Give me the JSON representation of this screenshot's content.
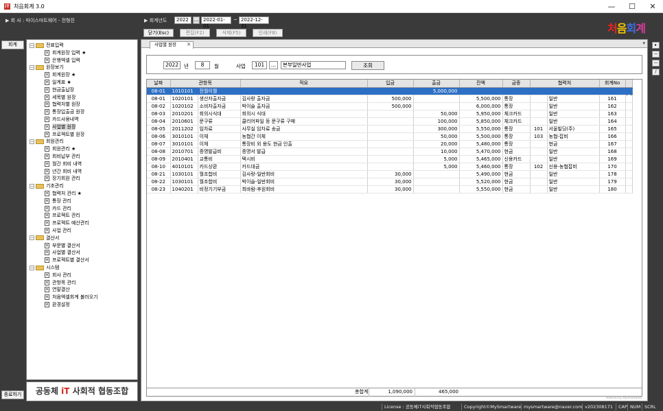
{
  "window": {
    "title": "처음회계 3.0",
    "app_icon": "iT",
    "minimize": "—",
    "maximize": "☐",
    "close": "✕"
  },
  "infobar": {
    "company_label": "▶ 회   사 : 마이스마트웨어 - 전형진",
    "fiscal_label": "▶ 회계년도",
    "fiscal_year": "2022",
    "dots": "...",
    "date_from": "2022-01-01",
    "tilde": "~",
    "date_to": "2022-12-31",
    "buttons": {
      "close": "닫기(Esc)",
      "edit": "편집(F2)",
      "delete": "삭제(F5)",
      "print": "인쇄(F8)"
    },
    "brand": [
      "처",
      "음",
      "회",
      "계"
    ],
    "brand_colors": [
      "#e8251f",
      "#f5c400",
      "#3e6de0",
      "#d63b9a"
    ]
  },
  "leftstrip": {
    "accounting_btn": "회계",
    "help_btn": "종료하기"
  },
  "tree": [
    {
      "type": "group",
      "label": "전표입력"
    },
    {
      "type": "item",
      "label": "회계원장 입력 ★"
    },
    {
      "type": "item",
      "label": "은행엑셀 입력"
    },
    {
      "type": "group",
      "label": "원장보기"
    },
    {
      "type": "item",
      "label": "회계원장 ★"
    },
    {
      "type": "item",
      "label": "일계표 ★"
    },
    {
      "type": "item",
      "label": "현금출납장"
    },
    {
      "type": "item",
      "label": "세목별 원장"
    },
    {
      "type": "item",
      "label": "협력처별 원장"
    },
    {
      "type": "item",
      "label": "통장입출금 원장"
    },
    {
      "type": "item",
      "label": "카드사용내역"
    },
    {
      "type": "item",
      "label": "사업별 원장",
      "selected": true
    },
    {
      "type": "item",
      "label": "프로젝트별 원장"
    },
    {
      "type": "group",
      "label": "회원관리"
    },
    {
      "type": "item",
      "label": "회원관리 ★"
    },
    {
      "type": "item",
      "label": "회비납부 관리"
    },
    {
      "type": "item",
      "label": "월간 회비 내역"
    },
    {
      "type": "item",
      "label": "년간 회비 내역"
    },
    {
      "type": "item",
      "label": "장기회원 관리"
    },
    {
      "type": "group",
      "label": "기초관리"
    },
    {
      "type": "item",
      "label": "협력처 관리 ★"
    },
    {
      "type": "item",
      "label": "통장 관리"
    },
    {
      "type": "item",
      "label": "카드 관리"
    },
    {
      "type": "item",
      "label": "프로젝트 관리"
    },
    {
      "type": "item",
      "label": "프로젝트 예산관리"
    },
    {
      "type": "item",
      "label": "사업 관리"
    },
    {
      "type": "group",
      "label": "결산서"
    },
    {
      "type": "item",
      "label": "부문별 결산서"
    },
    {
      "type": "item",
      "label": "사업별 결산서"
    },
    {
      "type": "item",
      "label": "프로젝트별 결산서"
    },
    {
      "type": "group",
      "label": "시스템"
    },
    {
      "type": "item",
      "label": "회사 관리"
    },
    {
      "type": "item",
      "label": "관항목 관리"
    },
    {
      "type": "item",
      "label": "연말결산"
    },
    {
      "type": "item",
      "label": "처음엑셀회계 불러오기"
    },
    {
      "type": "item",
      "label": "환경설정"
    }
  ],
  "org_name_prefix": "공동체 ",
  "org_name_it": "iT",
  "org_name_suffix": " 사회적 협동조합",
  "main": {
    "tab_label": "사업별 원장",
    "tab_close": "✕",
    "tab_arrow": "▾",
    "filter": {
      "year": "2022",
      "year_unit": "년",
      "month": "8",
      "month_unit": "월",
      "biz_label": "사업",
      "biz_code": "101",
      "dots": "...",
      "biz_name": "본부일반사업",
      "search_btn": "조회"
    },
    "columns": [
      "날짜",
      "관항목",
      "적요",
      "입금",
      "출금",
      "잔액",
      "금종",
      "협력처",
      "회계No"
    ],
    "rows": [
      [
        "08-01",
        "1010101",
        "전월이월",
        "",
        "",
        "5,000,000",
        "",
        "",
        "",
        "",
        ""
      ],
      [
        "08-01",
        "1020101",
        "생산자출자금",
        "김사랑 출자금",
        "500,000",
        "",
        "5,500,000",
        "통장",
        "",
        "일반",
        "161"
      ],
      [
        "08-02",
        "1020102",
        "소비자출자금",
        "박이슬 출자금",
        "500,000",
        "",
        "6,000,000",
        "통장",
        "",
        "일반",
        "162"
      ],
      [
        "08-03",
        "2010201",
        "회의시식대",
        "회의시 식대",
        "",
        "50,000",
        "5,950,000",
        "체크카드",
        "",
        "일반",
        "163"
      ],
      [
        "08-04",
        "2010601",
        "문구류",
        "클리어파일 등 문구류 구매",
        "",
        "100,000",
        "5,850,000",
        "체크카드",
        "",
        "일반",
        "164"
      ],
      [
        "08-05",
        "2011202",
        "임차료",
        "사무실 임차료 송금",
        "",
        "300,000",
        "5,550,000",
        "통장",
        "101",
        "서울빌딩(주)",
        "165"
      ],
      [
        "08-06",
        "3010101",
        "이체",
        "농협간 이체",
        "",
        "50,000",
        "5,500,000",
        "통장",
        "103",
        "농협-잡비",
        "166"
      ],
      [
        "08-07",
        "3010101",
        "이체",
        "통장비 외 용도 현금 인출",
        "",
        "20,000",
        "5,480,000",
        "통장",
        "",
        "현금",
        "167"
      ],
      [
        "08-08",
        "2010701",
        "증명발급비",
        "증명서 발급",
        "",
        "10,000",
        "5,470,000",
        "현금",
        "",
        "일반",
        "168"
      ],
      [
        "08-09",
        "2010401",
        "교통비",
        "택시비",
        "",
        "5,000",
        "5,465,000",
        "신용카드",
        "",
        "일반",
        "169"
      ],
      [
        "08-10",
        "4010101",
        "카드상환",
        "카드대금",
        "",
        "5,000",
        "5,460,000",
        "통장",
        "102",
        "신용-농협잡비",
        "170"
      ],
      [
        "08-21",
        "1030101",
        "월조합비",
        "김사랑-일반회비",
        "30,000",
        "",
        "5,490,000",
        "현금",
        "",
        "일반",
        "178"
      ],
      [
        "08-22",
        "1030101",
        "월조합비",
        "박이슬-일반회비",
        "30,000",
        "",
        "5,520,000",
        "현금",
        "",
        "일반",
        "179"
      ],
      [
        "08-23",
        "1040201",
        "비정기기부금",
        "최바람-후원회비",
        "30,000",
        "",
        "5,550,000",
        "현금",
        "",
        "일반",
        "180"
      ]
    ],
    "totals": {
      "label": "총합계",
      "income": "1,090,000",
      "expense": "465,000"
    },
    "powered": "Powered by MySmartware"
  },
  "rightstrip": [
    "▸",
    "—",
    "—",
    "/"
  ],
  "statusbar": {
    "license": "License : 공동체iT사회적협동조합",
    "copyright": "Copyright©MySmartware",
    "email": "mysmartware@naver.com",
    "version": "v202308171",
    "cap": "CAP",
    "num": "NUM",
    "scrl": "SCRL"
  }
}
